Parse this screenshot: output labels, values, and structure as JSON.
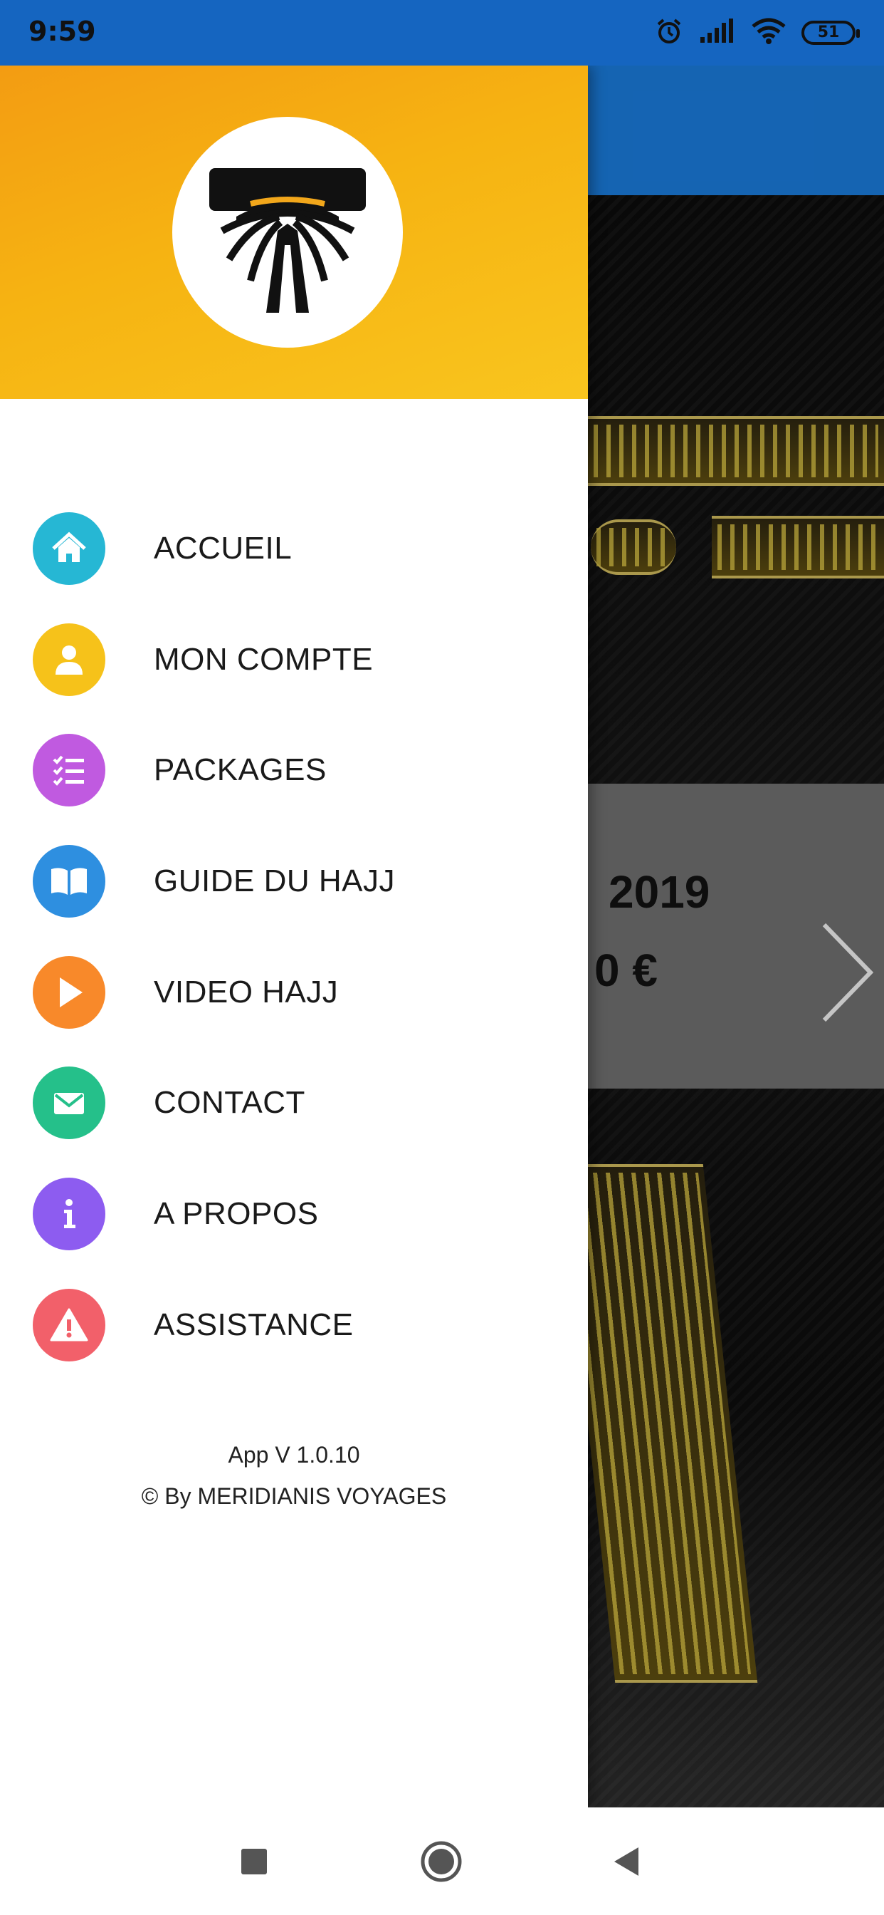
{
  "status_bar": {
    "time": "9:59",
    "battery": "51",
    "icons": [
      "alarm-icon",
      "signal-icon",
      "wifi-icon",
      "battery-icon"
    ]
  },
  "background": {
    "overlay_line1": "2019",
    "overlay_line2": "0 €",
    "chevron": "next-chevron-icon"
  },
  "drawer": {
    "logo": "app-logo",
    "header_colors": [
      "#f39c12",
      "#f9c51e"
    ],
    "menu": [
      {
        "label": "ACCUEIL",
        "icon": "home-icon",
        "color": "#26b7d4"
      },
      {
        "label": "MON COMPTE",
        "icon": "user-icon",
        "color": "#f6c21a"
      },
      {
        "label": "PACKAGES",
        "icon": "checklist-icon",
        "color": "#c05ae0"
      },
      {
        "label": "GUIDE DU HAJJ",
        "icon": "book-icon",
        "color": "#2e8fe0"
      },
      {
        "label": "VIDEO HAJJ",
        "icon": "play-icon",
        "color": "#f8892a"
      },
      {
        "label": "CONTACT",
        "icon": "mail-icon",
        "color": "#25c08a"
      },
      {
        "label": "A PROPOS",
        "icon": "info-icon",
        "color": "#8d5cf0"
      },
      {
        "label": "ASSISTANCE",
        "icon": "warning-icon",
        "color": "#f2606a"
      }
    ],
    "footer": {
      "version": "App V 1.0.10",
      "copyright": "© By MERIDIANIS VOYAGES"
    }
  },
  "nav_bar": {
    "buttons": [
      "recents-button",
      "home-button",
      "back-button"
    ]
  }
}
